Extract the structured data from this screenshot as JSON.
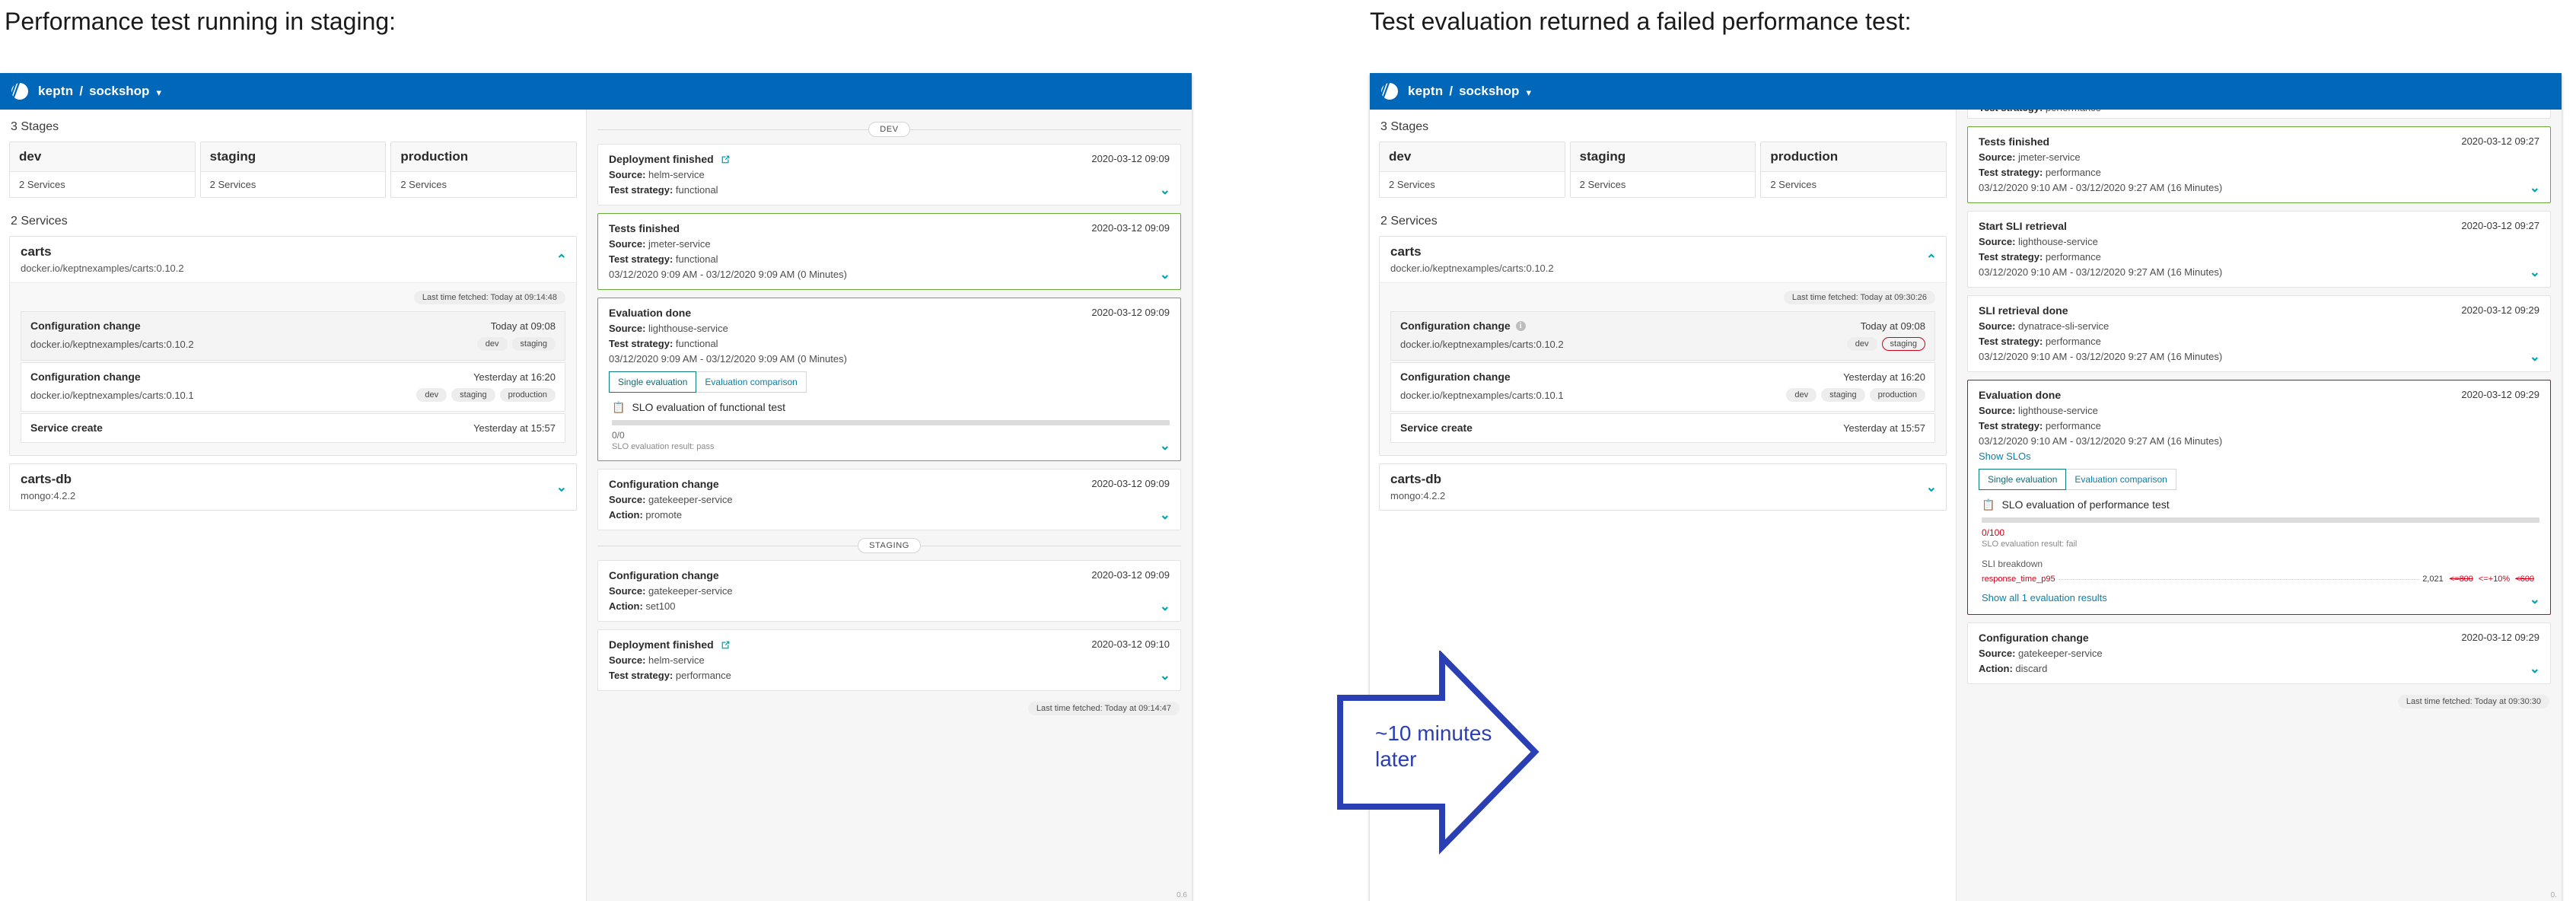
{
  "captions": {
    "left": "Performance test running in staging:",
    "right": "Test evaluation returned a failed performance test:"
  },
  "annotation": {
    "line1": "~10 minutes",
    "line2": "later",
    "color": "#2b3fb5"
  },
  "colors": {
    "brand": "#0067b9",
    "accent": "#00a3b1",
    "link": "#0b7fa6",
    "pass": "#6aaa3b",
    "fail": "#d0021b"
  },
  "topbar": {
    "logo_icon": "keptn-logo-icon",
    "brand": "keptn",
    "separator": "/",
    "project": "sockshop",
    "caret_icon": "chevron-down-icon"
  },
  "left_panel": {
    "stages_label": "3 Stages",
    "stages": [
      {
        "name": "dev",
        "services": "2 Services"
      },
      {
        "name": "staging",
        "services": "2 Services"
      },
      {
        "name": "production",
        "services": "2 Services"
      }
    ],
    "services_label": "2 Services",
    "services": [
      {
        "name": "carts",
        "image": "docker.io/keptnexamples/carts:0.10.2",
        "expanded": true,
        "chevron": "⌃",
        "fetched": "Last time fetched: Today at 09:14:48",
        "events": [
          {
            "name": "Configuration change",
            "time": "Today at 09:08",
            "image": "docker.io/keptnexamples/carts:0.10.2",
            "badges": [
              "dev",
              "staging"
            ],
            "shaded": true,
            "info": false,
            "highlight_badge": null
          },
          {
            "name": "Configuration change",
            "time": "Yesterday at 16:20",
            "image": "docker.io/keptnexamples/carts:0.10.1",
            "badges": [
              "dev",
              "staging",
              "production"
            ],
            "shaded": false,
            "info": false,
            "highlight_badge": null
          },
          {
            "name": "Service create",
            "time": "Yesterday at 15:57",
            "image": "",
            "badges": [],
            "shaded": false,
            "info": false,
            "highlight_badge": null
          }
        ]
      },
      {
        "name": "carts-db",
        "image": "mongo:4.2.2",
        "expanded": false,
        "chevron": "⌄",
        "fetched": "",
        "events": []
      }
    ],
    "timeline": [
      {
        "kind": "divider",
        "label": "DEV"
      },
      {
        "kind": "card",
        "status": "none",
        "title": "Deployment finished",
        "ext_link": true,
        "date": "2020-03-12 09:09",
        "lines": [
          {
            "k": "Source:",
            "v": "helm-service"
          },
          {
            "k": "Test strategy:",
            "v": "functional"
          }
        ],
        "range": "",
        "chevron": "⌄"
      },
      {
        "kind": "card",
        "status": "pass",
        "title": "Tests finished",
        "ext_link": false,
        "date": "2020-03-12 09:09",
        "lines": [
          {
            "k": "Source:",
            "v": "jmeter-service"
          },
          {
            "k": "Test strategy:",
            "v": "functional"
          }
        ],
        "range": "03/12/2020 9:09 AM - 03/12/2020 9:09 AM (0 Minutes)",
        "chevron": "⌄"
      },
      {
        "kind": "eval",
        "status": "pass",
        "title": "Evaluation done",
        "ext_link": false,
        "date": "2020-03-12 09:09",
        "lines": [
          {
            "k": "Source:",
            "v": "lighthouse-service"
          },
          {
            "k": "Test strategy:",
            "v": "functional"
          }
        ],
        "range": "03/12/2020 9:09 AM - 03/12/2020 9:09 AM (0 Minutes)",
        "show_slos": null,
        "toggle": {
          "active": "Single evaluation",
          "inactive": "Evaluation comparison"
        },
        "slo": {
          "icon": "clipboard-icon",
          "title": "SLO evaluation of functional test",
          "bar_percent": 100,
          "score": "0/0",
          "score_fail": false,
          "result": "SLO evaluation result: pass",
          "sli_head": null,
          "sli_rows": [],
          "show_all": null
        },
        "chevron": "⌄"
      },
      {
        "kind": "card",
        "status": "none",
        "title": "Configuration change",
        "ext_link": false,
        "date": "2020-03-12 09:09",
        "lines": [
          {
            "k": "Source:",
            "v": "gatekeeper-service"
          },
          {
            "k": "Action:",
            "v": "promote"
          }
        ],
        "range": "",
        "chevron": "⌄"
      },
      {
        "kind": "divider",
        "label": "STAGING"
      },
      {
        "kind": "card",
        "status": "none",
        "title": "Configuration change",
        "ext_link": false,
        "date": "2020-03-12 09:09",
        "lines": [
          {
            "k": "Source:",
            "v": "gatekeeper-service"
          },
          {
            "k": "Action:",
            "v": "set100"
          }
        ],
        "range": "",
        "chevron": "⌄"
      },
      {
        "kind": "card",
        "status": "none",
        "title": "Deployment finished",
        "ext_link": true,
        "date": "2020-03-12 09:10",
        "lines": [
          {
            "k": "Source:",
            "v": "helm-service"
          },
          {
            "k": "Test strategy:",
            "v": "performance"
          }
        ],
        "range": "",
        "chevron": "⌄"
      }
    ],
    "timeline_fetched": "Last time fetched: Today at 09:14:47",
    "zoom_tag": "0.6"
  },
  "right_panel": {
    "stages_label": "3 Stages",
    "stages": [
      {
        "name": "dev",
        "services": "2 Services"
      },
      {
        "name": "staging",
        "services": "2 Services"
      },
      {
        "name": "production",
        "services": "2 Services"
      }
    ],
    "services_label": "2 Services",
    "services": [
      {
        "name": "carts",
        "image": "docker.io/keptnexamples/carts:0.10.2",
        "expanded": true,
        "chevron": "⌃",
        "fetched": "Last time fetched: Today at 09:30:26",
        "events": [
          {
            "name": "Configuration change",
            "time": "Today at 09:08",
            "image": "docker.io/keptnexamples/carts:0.10.2",
            "badges": [
              "dev",
              "staging"
            ],
            "shaded": true,
            "info": true,
            "highlight_badge": "staging"
          },
          {
            "name": "Configuration change",
            "time": "Yesterday at 16:20",
            "image": "docker.io/keptnexamples/carts:0.10.1",
            "badges": [
              "dev",
              "staging",
              "production"
            ],
            "shaded": false,
            "info": false,
            "highlight_badge": null
          },
          {
            "name": "Service create",
            "time": "Yesterday at 15:57",
            "image": "",
            "badges": [],
            "shaded": false,
            "info": false,
            "highlight_badge": null
          }
        ]
      },
      {
        "name": "carts-db",
        "image": "mongo:4.2.2",
        "expanded": false,
        "chevron": "⌄",
        "fetched": "",
        "events": []
      }
    ],
    "timeline_partial_top": {
      "k": "Test strategy:",
      "v": "performance",
      "chevron": "⌄"
    },
    "timeline": [
      {
        "kind": "card",
        "status": "pass",
        "title": "Tests finished",
        "ext_link": false,
        "date": "2020-03-12 09:27",
        "lines": [
          {
            "k": "Source:",
            "v": "jmeter-service"
          },
          {
            "k": "Test strategy:",
            "v": "performance"
          }
        ],
        "range": "03/12/2020 9:10 AM - 03/12/2020 9:27 AM (16 Minutes)",
        "chevron": "⌄"
      },
      {
        "kind": "card",
        "status": "none",
        "title": "Start SLI retrieval",
        "ext_link": false,
        "date": "2020-03-12 09:27",
        "lines": [
          {
            "k": "Source:",
            "v": "lighthouse-service"
          },
          {
            "k": "Test strategy:",
            "v": "performance"
          }
        ],
        "range": "03/12/2020 9:10 AM - 03/12/2020 9:27 AM (16 Minutes)",
        "chevron": "⌄"
      },
      {
        "kind": "card",
        "status": "none",
        "title": "SLI retrieval done",
        "ext_link": false,
        "date": "2020-03-12 09:29",
        "lines": [
          {
            "k": "Source:",
            "v": "dynatrace-sli-service"
          },
          {
            "k": "Test strategy:",
            "v": "performance"
          }
        ],
        "range": "03/12/2020 9:10 AM - 03/12/2020 9:27 AM (16 Minutes)",
        "chevron": "⌄"
      },
      {
        "kind": "eval",
        "status": "fail",
        "title": "Evaluation done",
        "ext_link": false,
        "date": "2020-03-12 09:29",
        "lines": [
          {
            "k": "Source:",
            "v": "lighthouse-service"
          },
          {
            "k": "Test strategy:",
            "v": "performance"
          }
        ],
        "range": "03/12/2020 9:10 AM - 03/12/2020 9:27 AM (16 Minutes)",
        "show_slos": "Show SLOs",
        "toggle": {
          "active": "Single evaluation",
          "inactive": "Evaluation comparison"
        },
        "slo": {
          "icon": "clipboard-icon",
          "title": "SLO evaluation of performance test",
          "bar_percent": 100,
          "score": "0/100",
          "score_fail": true,
          "result": "SLO evaluation result: fail",
          "sli_head": "SLI breakdown",
          "sli_rows": [
            {
              "key": "response_time_p95",
              "value": "2,021",
              "thresholds": [
                {
                  "t": "<=800",
                  "strike": true
                },
                {
                  "t": "<=+10%",
                  "strike": false
                },
                {
                  "t": "<600",
                  "strike": true
                }
              ]
            }
          ],
          "show_all": "Show all 1 evaluation results"
        },
        "chevron": "⌄"
      },
      {
        "kind": "card",
        "status": "none",
        "title": "Configuration change",
        "ext_link": false,
        "date": "2020-03-12 09:29",
        "lines": [
          {
            "k": "Source:",
            "v": "gatekeeper-service"
          },
          {
            "k": "Action:",
            "v": "discard"
          }
        ],
        "range": "",
        "chevron": "⌄"
      }
    ],
    "timeline_fetched": "Last time fetched: Today at 09:30:30",
    "zoom_tag": "0."
  }
}
